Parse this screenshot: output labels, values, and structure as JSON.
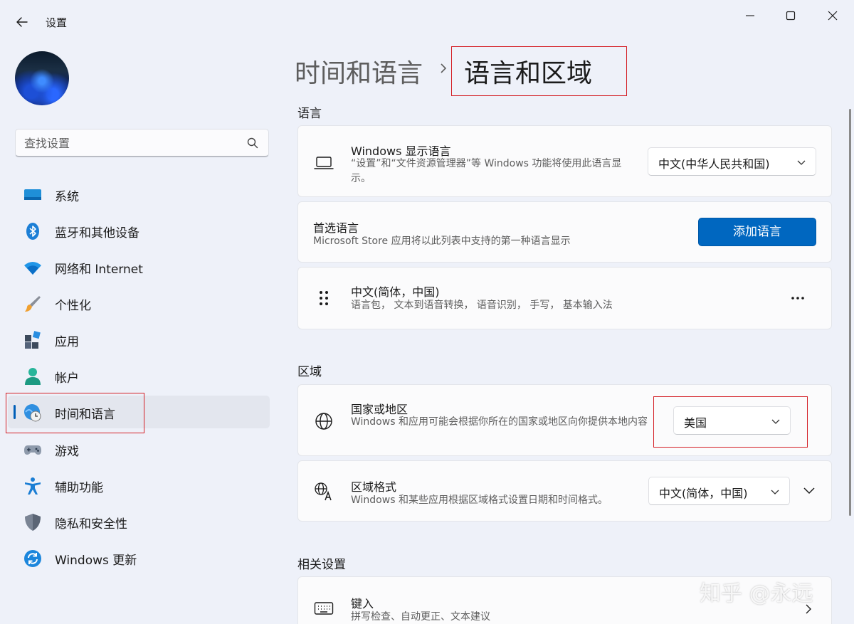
{
  "window": {
    "title": "设置"
  },
  "search": {
    "placeholder": "查找设置"
  },
  "sidebar": {
    "items": [
      {
        "label": "系统",
        "icon": "system-icon"
      },
      {
        "label": "蓝牙和其他设备",
        "icon": "bluetooth-icon"
      },
      {
        "label": "网络和 Internet",
        "icon": "wifi-icon"
      },
      {
        "label": "个性化",
        "icon": "brush-icon"
      },
      {
        "label": "应用",
        "icon": "apps-icon"
      },
      {
        "label": "帐户",
        "icon": "account-icon"
      },
      {
        "label": "时间和语言",
        "icon": "time-language-icon",
        "active": true
      },
      {
        "label": "游戏",
        "icon": "gamepad-icon"
      },
      {
        "label": "辅助功能",
        "icon": "accessibility-icon"
      },
      {
        "label": "隐私和安全性",
        "icon": "shield-icon"
      },
      {
        "label": "Windows 更新",
        "icon": "update-icon"
      }
    ]
  },
  "breadcrumb": {
    "parent": "时间和语言",
    "current": "语言和区域"
  },
  "language": {
    "section_title": "语言",
    "display_language": {
      "title": "Windows 显示语言",
      "description": "“设置”和“文件资源管理器”等 Windows 功能将使用此语言显示。",
      "value": "中文(中华人民共和国)"
    },
    "preferred": {
      "title": "首选语言",
      "description": "Microsoft Store 应用将以此列表中支持的第一种语言显示",
      "add_button": "添加语言"
    },
    "installed": {
      "title": "中文(简体，中国)",
      "description": "语言包， 文本到语音转换， 语音识别， 手写， 基本输入法",
      "more": "⋯"
    }
  },
  "region": {
    "section_title": "区域",
    "country": {
      "title": "国家或地区",
      "description": "Windows 和应用可能会根据你所在的国家或地区向你提供本地内容",
      "value": "美国"
    },
    "format": {
      "title": "区域格式",
      "description": "Windows 和某些应用根据区域格式设置日期和时间格式。",
      "value": "中文(简体，中国)"
    }
  },
  "related": {
    "section_title": "相关设置",
    "typing": {
      "title": "键入",
      "description": "拼写检查、自动更正、文本建议"
    }
  },
  "watermark": "知乎 @永远",
  "colors": {
    "accent": "#0067c0",
    "highlight_border": "#d41e25",
    "background": "#eef1f9"
  }
}
